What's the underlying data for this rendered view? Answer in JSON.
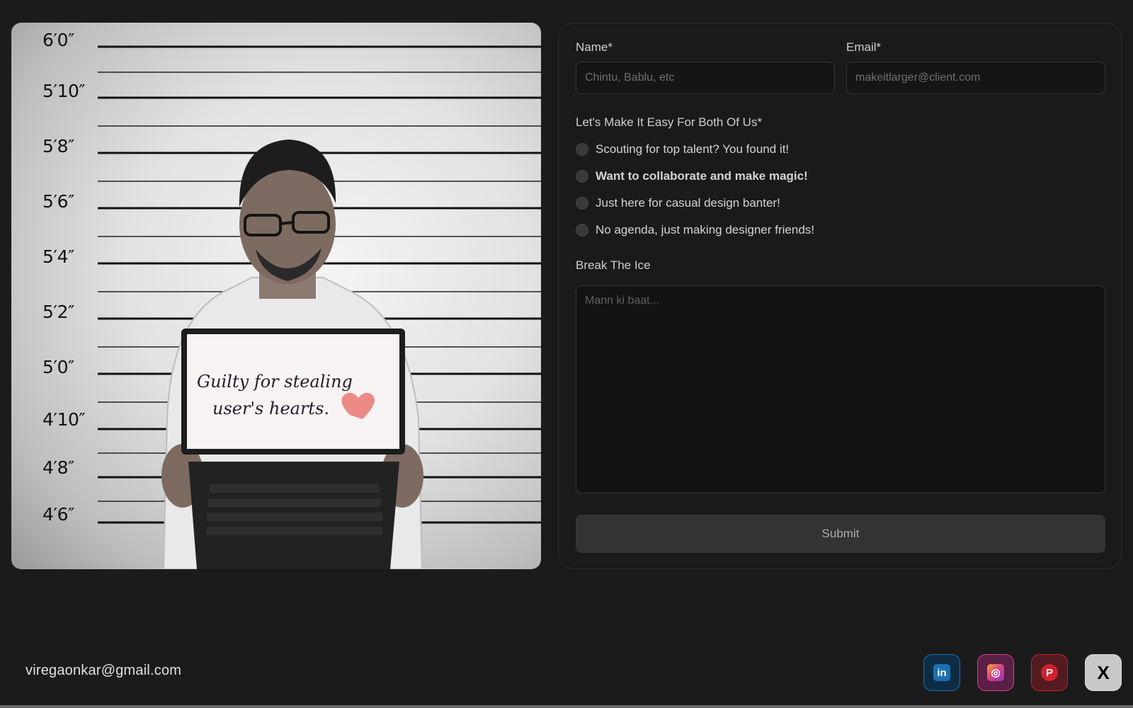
{
  "photo": {
    "height_marks": [
      "6′0″",
      "5′10″",
      "5′8″",
      "5′6″",
      "5′4″",
      "5′2″",
      "5′0″",
      "4′10″",
      "4′8″",
      "4′6″"
    ],
    "sign_line_1": "Guilty for stealing",
    "sign_line_2": "user's hearts."
  },
  "form": {
    "name_label": "Name*",
    "name_placeholder": "Chintu, Bablu, etc",
    "email_label": "Email*",
    "email_placeholder": "makeitlarger@client.com",
    "intent_label": "Let's Make It Easy For Both Of Us*",
    "options": [
      "Scouting for top talent? You found it!",
      "Want to collaborate and make magic!",
      "Just here for casual design banter!",
      "No agenda, just making designer friends!"
    ],
    "selected_option_emphasis": 1,
    "message_label": "Break The Ice",
    "message_placeholder": "Mann ki baat...",
    "submit_label": "Submit"
  },
  "footer": {
    "email": "viregaonkar@gmail.com",
    "socials": [
      {
        "name": "linkedin-icon",
        "glyph": "in",
        "color": "#1d6fb3",
        "bg": "#0f2c45"
      },
      {
        "name": "instagram-icon",
        "glyph": "◎",
        "color": "#d8408a",
        "bg": "#5a1f44"
      },
      {
        "name": "pinterest-icon",
        "glyph": "P",
        "color": "#d0212f",
        "bg": "#531a1f"
      },
      {
        "name": "x-icon",
        "glyph": "X",
        "color": "#000000",
        "bg": "#c8c8c8"
      }
    ]
  }
}
